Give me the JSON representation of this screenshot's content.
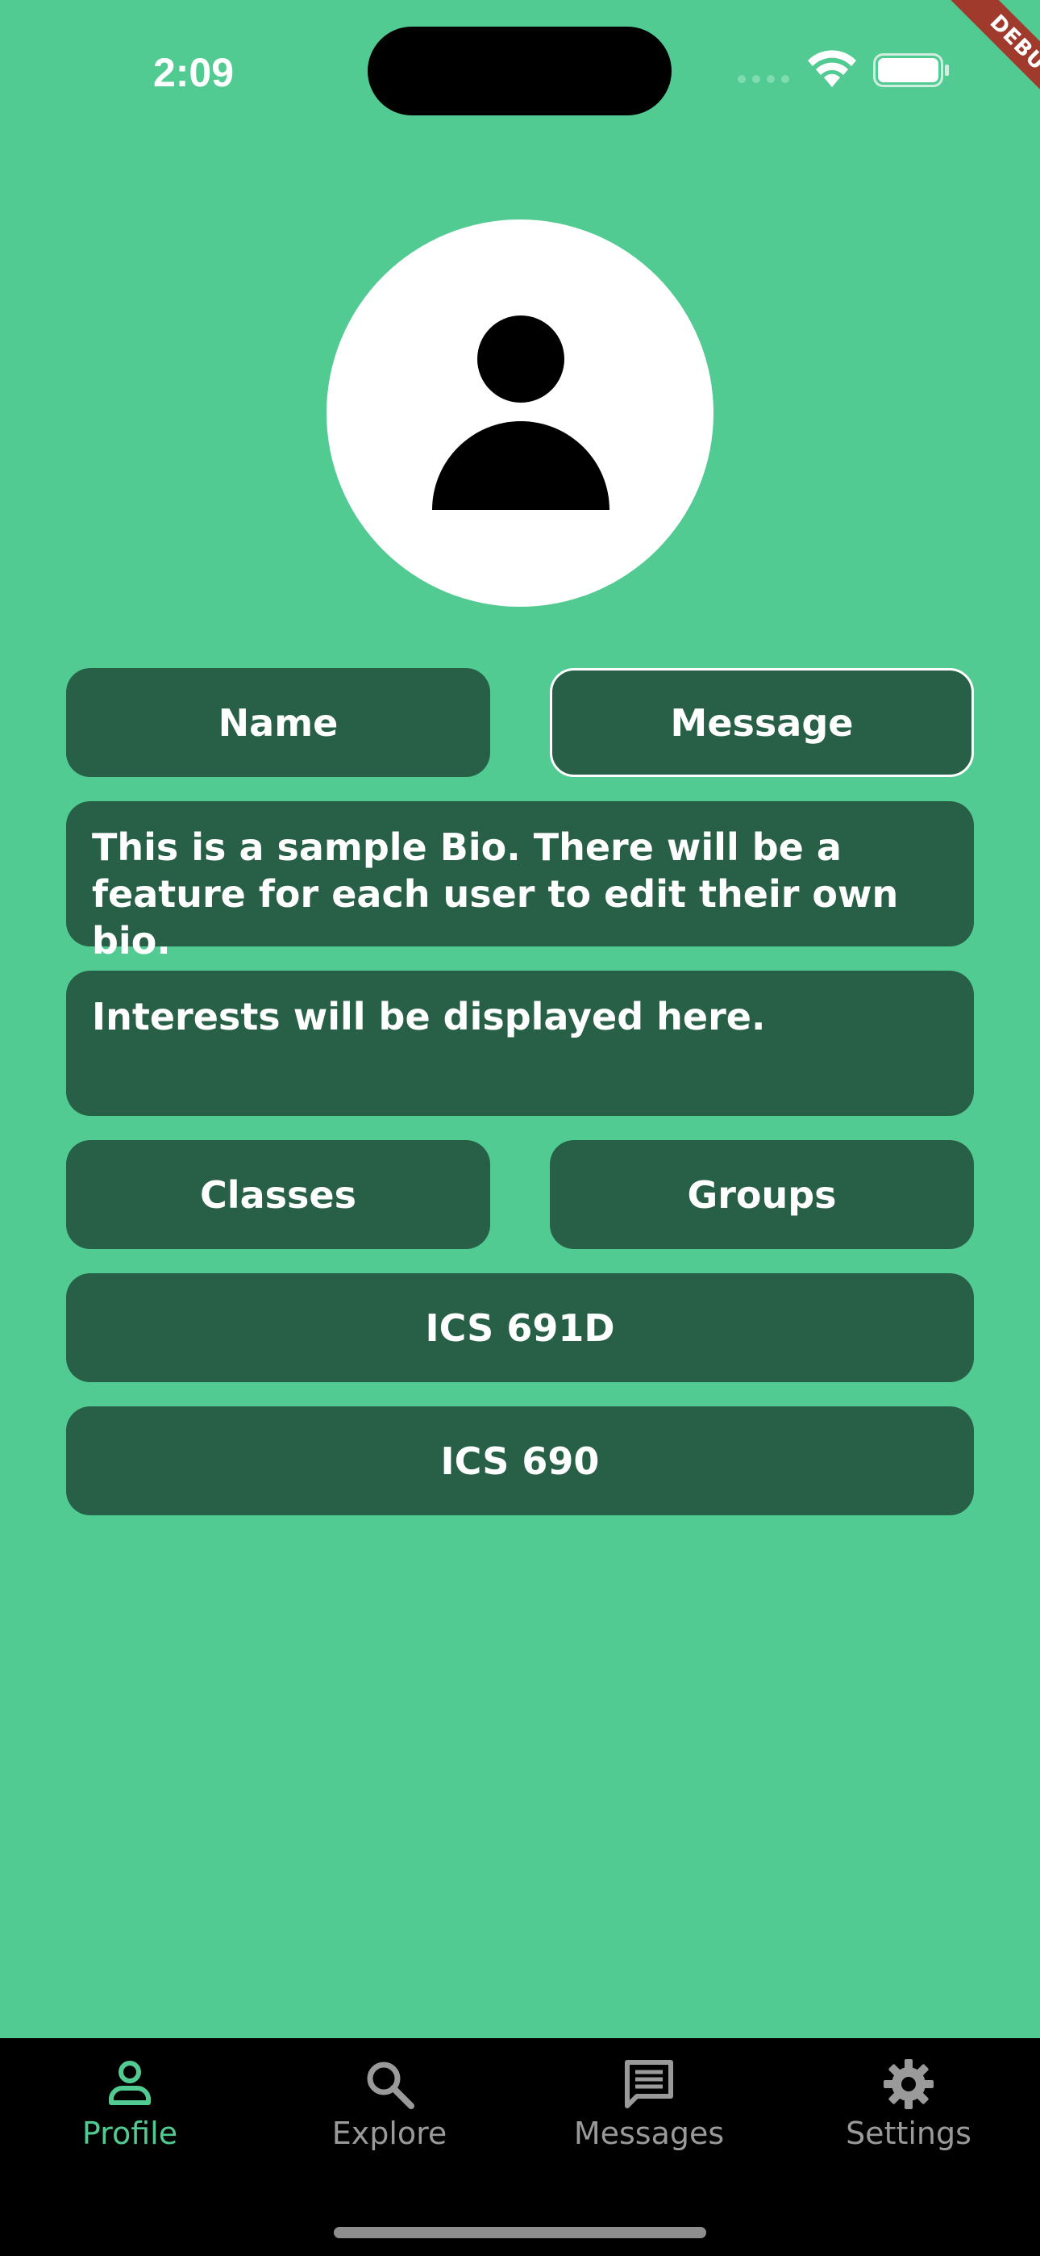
{
  "status_bar": {
    "time": "2:09",
    "debug_label": "DEBUG"
  },
  "profile": {
    "name_button": "Name",
    "message_button": "Message",
    "bio": "This is a sample Bio. There will be a feature for each user to edit their own bio.",
    "interests": "Interests will be displayed here.",
    "classes_button": "Classes",
    "groups_button": "Groups",
    "classes": [
      "ICS 691D",
      "ICS 690"
    ]
  },
  "nav": {
    "items": [
      {
        "label": "Profile",
        "icon": "person-icon",
        "active": true
      },
      {
        "label": "Explore",
        "icon": "search-icon",
        "active": false
      },
      {
        "label": "Messages",
        "icon": "message-icon",
        "active": false
      },
      {
        "label": "Settings",
        "icon": "gear-icon",
        "active": false
      }
    ]
  },
  "colors": {
    "background": "#52CB93",
    "card": "#276047",
    "nav_background": "#000000",
    "nav_active": "#52CB93",
    "nav_inactive": "#9a9a9a"
  }
}
